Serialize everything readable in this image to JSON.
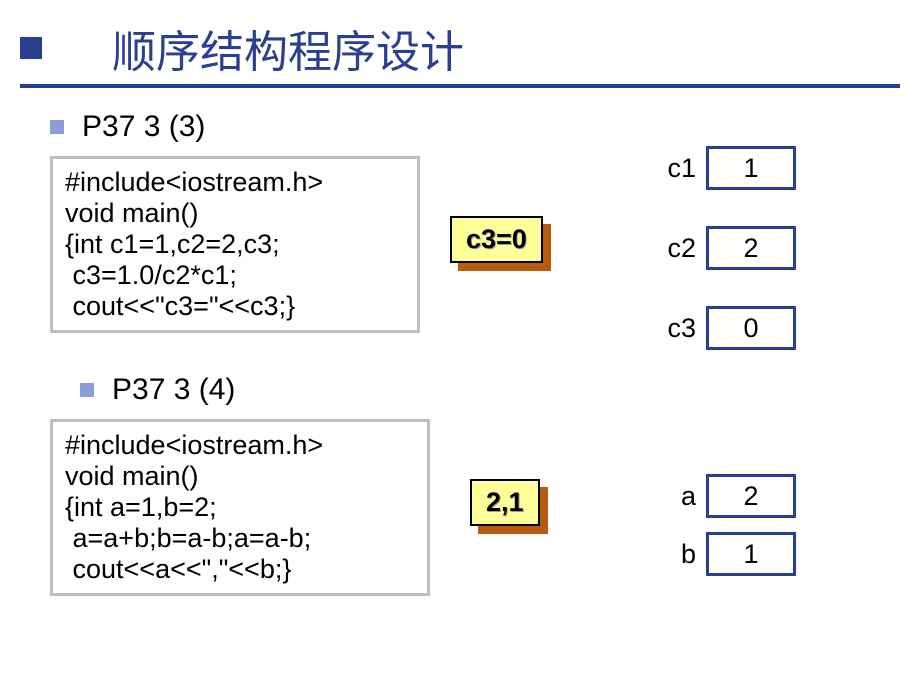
{
  "title": "顺序结构程序设计",
  "section1": {
    "bullet": "P37 3 (3)",
    "code": "#include<iostream.h>\nvoid main()\n{int c1=1,c2=2,c3;\n c3=1.0/c2*c1;\n cout<<\"c3=\"<<c3;}",
    "result": "c3=0",
    "vars": [
      {
        "name": "c1",
        "value": "1"
      },
      {
        "name": "c2",
        "value": "2"
      },
      {
        "name": "c3",
        "value": "0"
      }
    ]
  },
  "section2": {
    "bullet": "P37 3 (4)",
    "code": "#include<iostream.h>\nvoid main()\n{int a=1,b=2;\n a=a+b;b=a-b;a=a-b;\n cout<<a<<\",\"<<b;}",
    "result": "2,1",
    "vars": [
      {
        "name": "a",
        "value": "2"
      },
      {
        "name": "b",
        "value": "1"
      }
    ]
  }
}
